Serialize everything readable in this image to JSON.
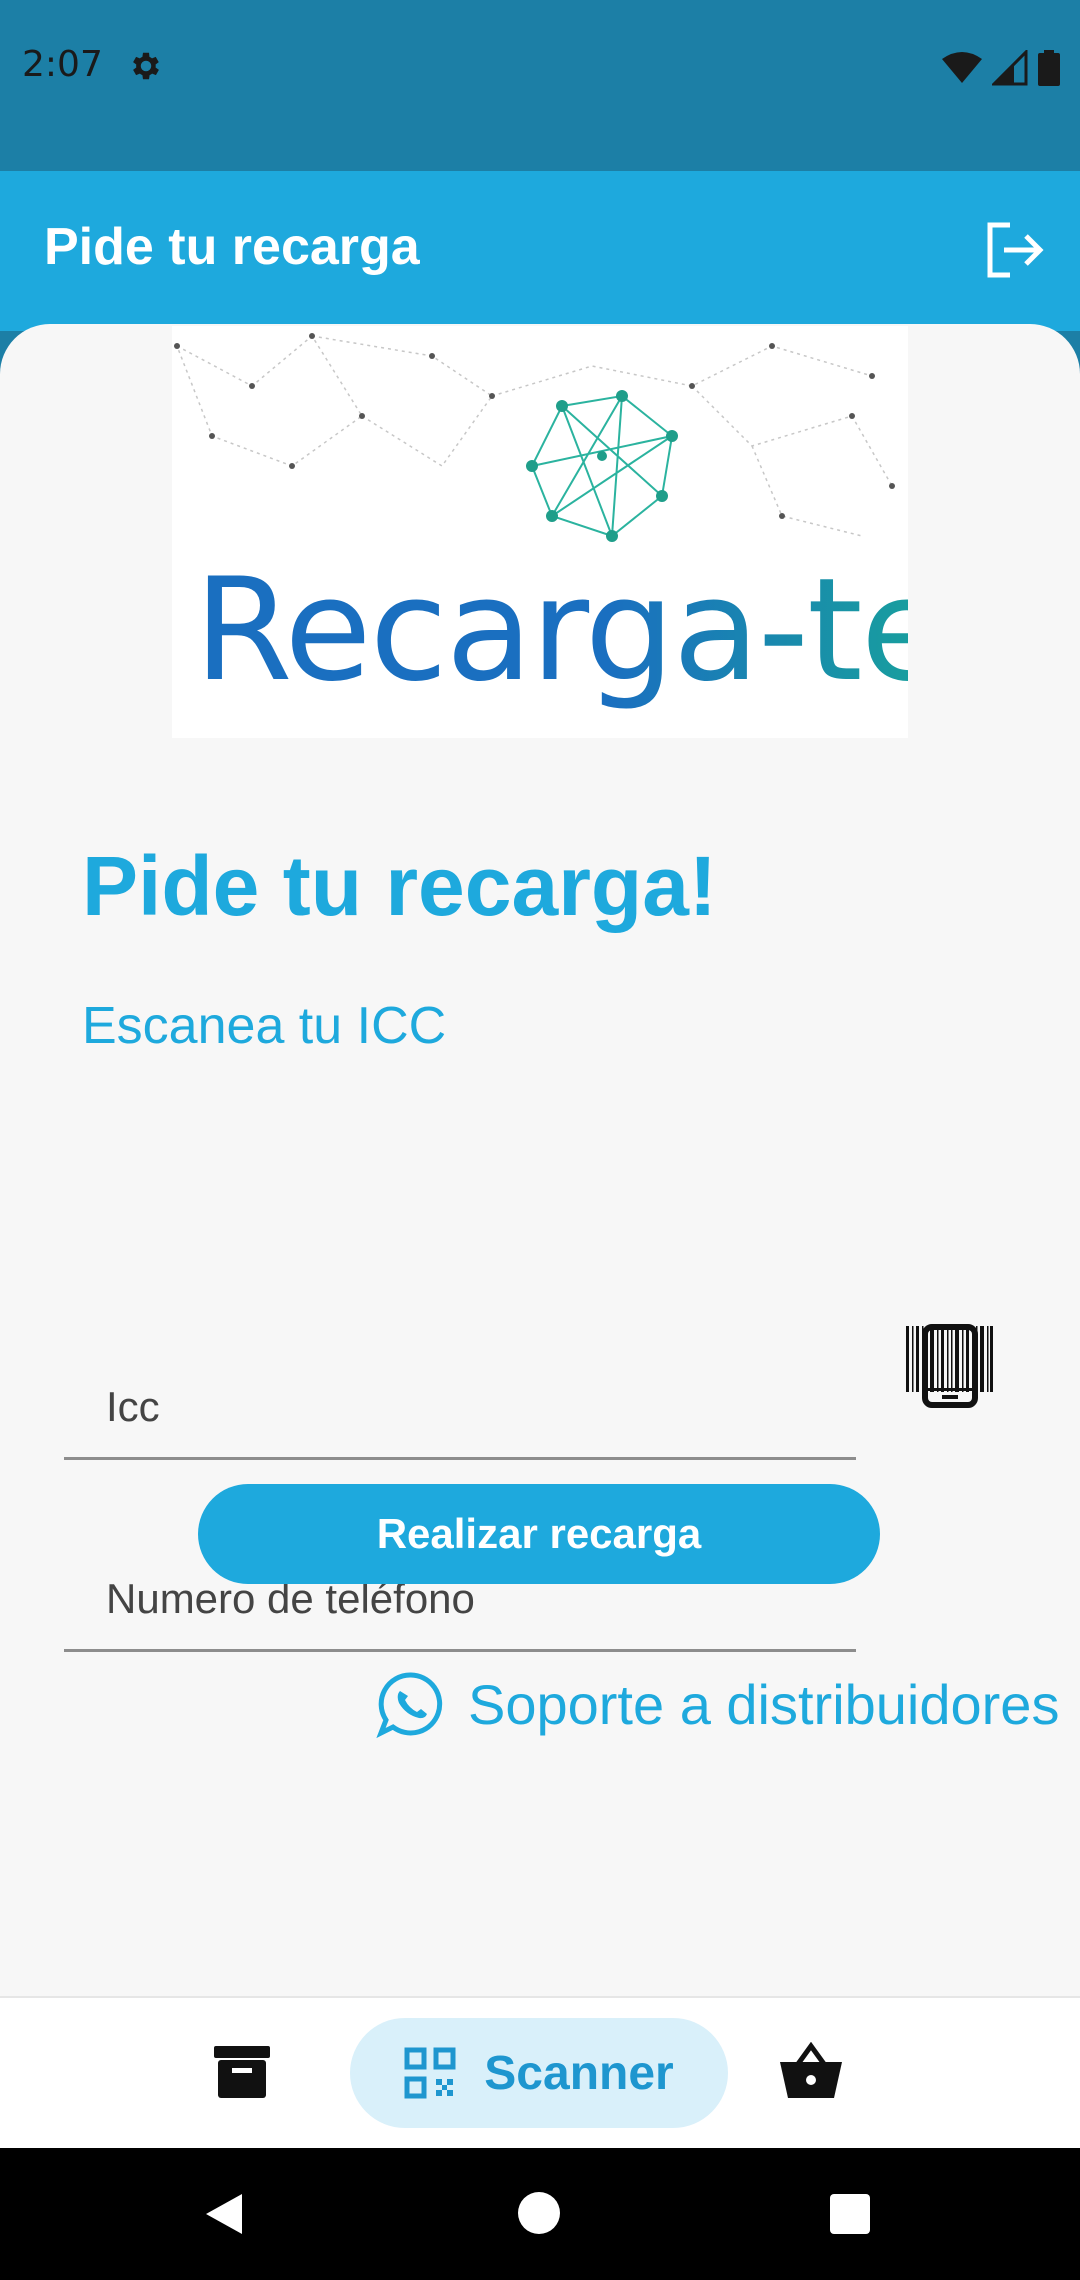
{
  "status_bar": {
    "time": "2:07"
  },
  "app_bar": {
    "title": "Pide tu recarga"
  },
  "logo": {
    "text": "Recarga-te"
  },
  "main": {
    "heading": "Pide tu recarga!",
    "subheading": "Escanea tu ICC",
    "icc_field": {
      "placeholder": "Icc",
      "value": ""
    },
    "phone_field": {
      "placeholder": "Numero de teléfono",
      "value": ""
    },
    "submit_label": "Realizar recarga",
    "support_label": "Soporte a distribuidores"
  },
  "bottom_nav": {
    "scanner_label": "Scanner"
  },
  "colors": {
    "status_bar": "#1c7fa6",
    "app_bar": "#1ea9dd",
    "accent": "#1ea9dd",
    "scanner_pill": "#d9f0fa"
  }
}
